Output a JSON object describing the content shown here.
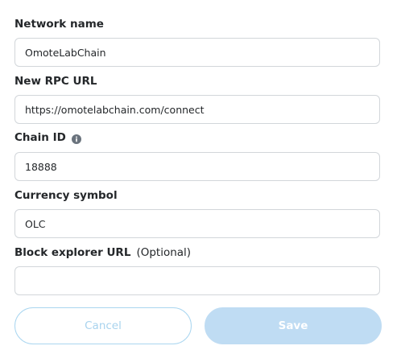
{
  "form": {
    "network_name": {
      "label": "Network name",
      "value": "OmoteLabChain"
    },
    "rpc_url": {
      "label": "New RPC URL",
      "value": "https://omotelabchain.com/connect"
    },
    "chain_id": {
      "label": "Chain ID",
      "value": "18888",
      "icon": "info-icon"
    },
    "currency_symbol": {
      "label": "Currency symbol",
      "value": "OLC"
    },
    "block_explorer": {
      "label": "Block explorer URL",
      "optional": "(Optional)",
      "value": ""
    }
  },
  "actions": {
    "cancel_label": "Cancel",
    "save_label": "Save"
  },
  "colors": {
    "text": "#24272a",
    "border": "#d2d6da",
    "cancel_border": "#aad6f0",
    "cancel_text": "#a8d3ee",
    "save_bg": "#bfdcf3",
    "info_icon": "#6a737d"
  }
}
